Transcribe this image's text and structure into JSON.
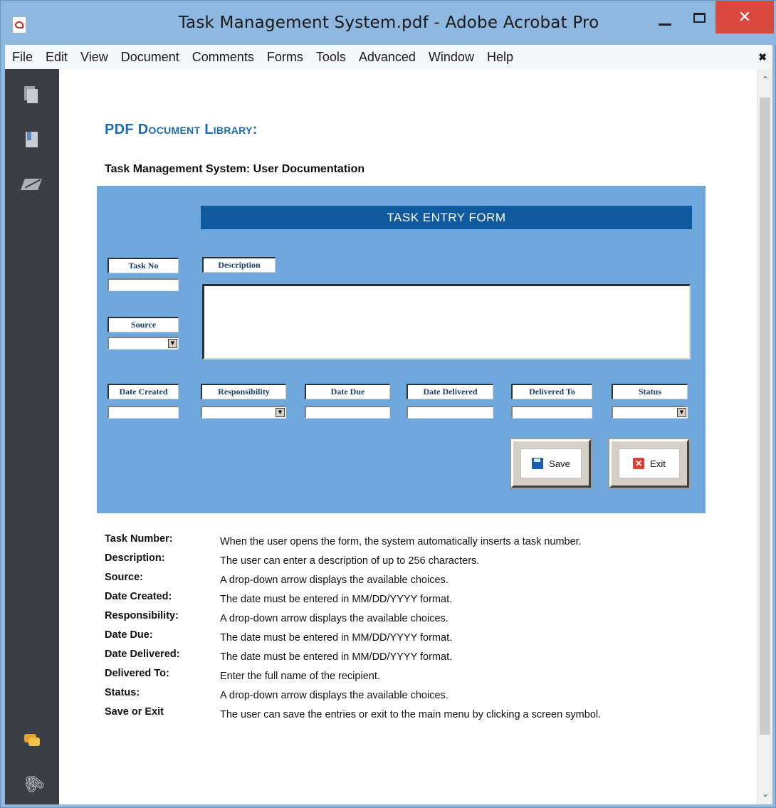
{
  "window": {
    "title": "Task Management System.pdf - Adobe Acrobat Pro",
    "minimize_glyph": "—",
    "maximize_glyph": "☐",
    "close_glyph": "✕"
  },
  "menu": {
    "items": [
      "File",
      "Edit",
      "View",
      "Document",
      "Comments",
      "Forms",
      "Tools",
      "Advanced",
      "Window",
      "Help"
    ],
    "close_glyph": "✖"
  },
  "nav_icons": [
    "pages-icon",
    "bookmarks-icon",
    "signatures-icon",
    "comments-icon",
    "attachments-icon"
  ],
  "document": {
    "library_title": "PDF Document Library:",
    "subtitle": "Task Management System: User Documentation",
    "form": {
      "header": "TASK ENTRY FORM",
      "labels": {
        "task_no": "Task No",
        "description": "Description",
        "source": "Source",
        "date_created": "Date Created",
        "responsibility": "Responsibility",
        "date_due": "Date Due",
        "date_delivered": "Date Delivered",
        "delivered_to": "Delivered To",
        "status": "Status"
      },
      "save_label": "Save",
      "exit_label": "Exit",
      "exit_glyph": "✕",
      "combo_glyph": "▼"
    },
    "documentation": [
      {
        "term": "Task Number:",
        "definition": "When the user opens the form, the system automatically inserts a task number."
      },
      {
        "term": "Description:",
        "definition": "The user can enter a description of up to 256 characters."
      },
      {
        "term": "Source:",
        "definition": "A drop-down arrow displays the available choices."
      },
      {
        "term": "Date Created:",
        "definition": "The date must be entered in MM/DD/YYYY format."
      },
      {
        "term": "Responsibility:",
        "definition": "A drop-down arrow displays the available choices."
      },
      {
        "term": "Date Due:",
        "definition": "The date must be entered in MM/DD/YYYY format."
      },
      {
        "term": "Date Delivered:",
        "definition": "The date must be entered in MM/DD/YYYY format."
      },
      {
        "term": "Delivered To:",
        "definition": "Enter the full name of the recipient."
      },
      {
        "term": "Status:",
        "definition": "A drop-down arrow displays the available choices."
      },
      {
        "term": "Save or Exit",
        "definition": "The user can save the entries or exit to the main menu by clicking a screen symbol."
      }
    ]
  },
  "colors": {
    "titlebar": "#8fb8e0",
    "close_button": "#d9493e",
    "nav_panel": "#3b3f45",
    "library_title": "#1b6bb5",
    "form_panel": "#6fa8dc",
    "form_header": "#0f5a9e"
  }
}
